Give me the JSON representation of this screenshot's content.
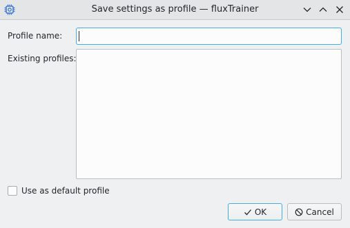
{
  "window": {
    "title": "Save settings as profile — fluxTrainer",
    "icons": {
      "app": "app-chip-icon",
      "minimize": "chevron-down-icon",
      "maximize": "chevron-up-icon",
      "close": "close-icon"
    }
  },
  "form": {
    "profile_name_label": "Profile name:",
    "profile_name_value": "",
    "profile_name_placeholder": "",
    "existing_profiles_label": "Existing profiles:",
    "existing_profiles": [],
    "default_checkbox_label": "Use as default profile",
    "default_checkbox_checked": false
  },
  "buttons": {
    "ok_label": "OK",
    "ok_icon": "checkmark-icon",
    "cancel_label": "Cancel",
    "cancel_icon": "cancel-circle-icon"
  },
  "colors": {
    "accent": "#3daee9",
    "window_bg": "#eff0f1",
    "titlebar_bg": "#e3e5e7",
    "app_icon": "#3d78d8"
  }
}
